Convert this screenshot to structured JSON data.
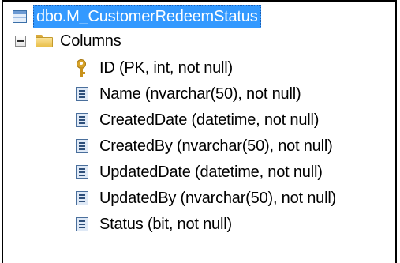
{
  "tree": {
    "table": {
      "label": "dbo.M_CustomerRedeemStatus",
      "icon": "table-icon",
      "selected": true,
      "selection_color": "#3399ff"
    },
    "columns_folder": {
      "label": "Columns",
      "icon": "folder-icon",
      "expand_icon": "collapse-icon"
    },
    "columns": [
      {
        "label": "ID (PK, int, not null)",
        "icon": "primary-key-icon"
      },
      {
        "label": "Name (nvarchar(50), not null)",
        "icon": "column-icon"
      },
      {
        "label": "CreatedDate (datetime, not null)",
        "icon": "column-icon"
      },
      {
        "label": "CreatedBy (nvarchar(50), not null)",
        "icon": "column-icon"
      },
      {
        "label": "UpdatedDate (datetime, not null)",
        "icon": "column-icon"
      },
      {
        "label": "UpdatedBy (nvarchar(50), not null)",
        "icon": "column-icon"
      },
      {
        "label": "Status (bit, not null)",
        "icon": "column-icon"
      }
    ]
  }
}
